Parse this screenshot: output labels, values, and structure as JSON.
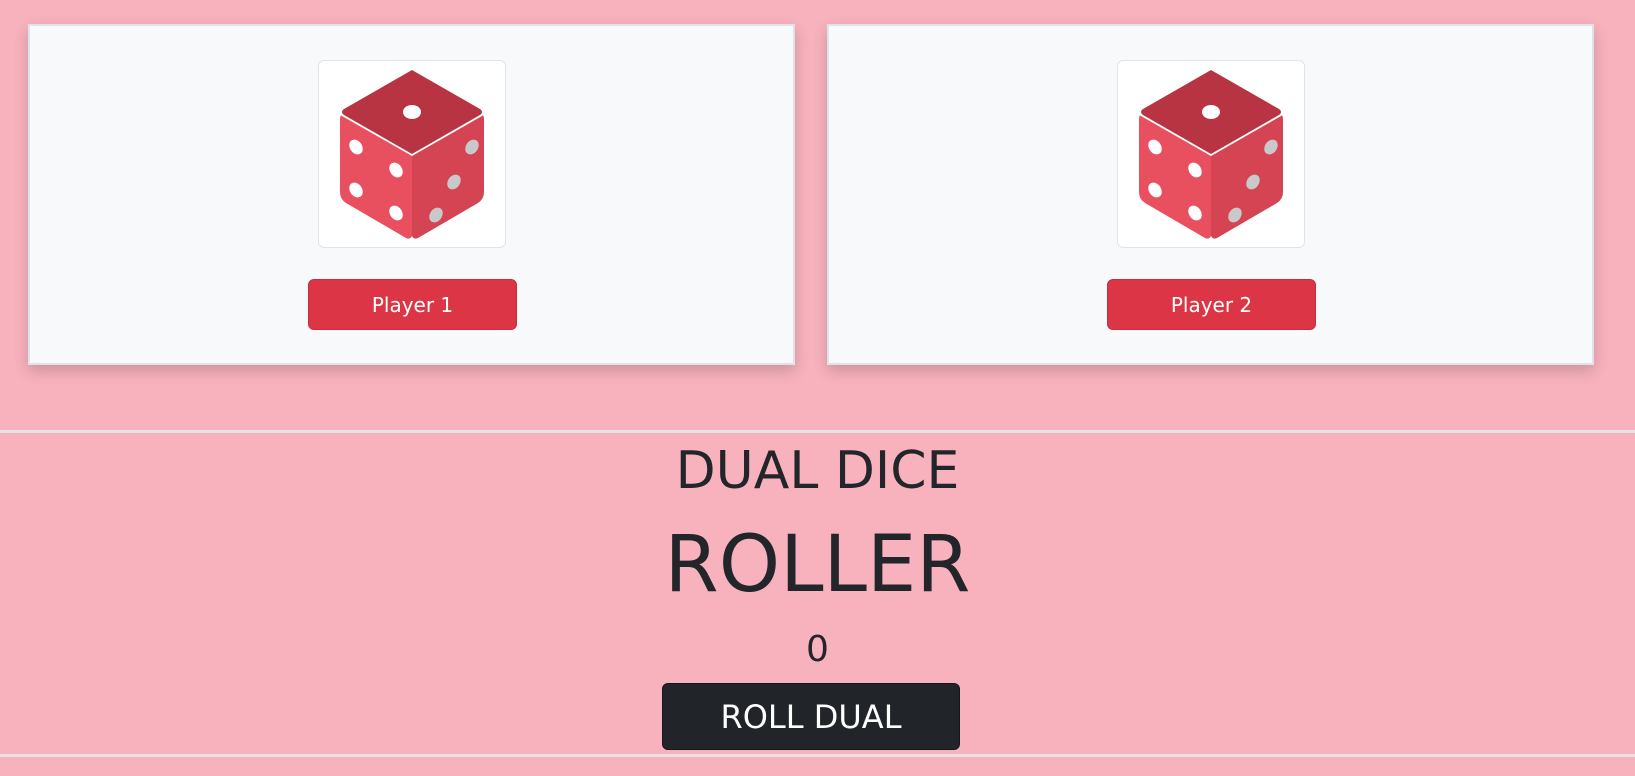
{
  "players": [
    {
      "button_label": "Player 1",
      "die_icon": "dice-icon"
    },
    {
      "button_label": "Player 2",
      "die_icon": "dice-icon"
    }
  ],
  "game": {
    "title_line1": "DUAL DICE",
    "title_line2": "ROLLER",
    "score": "0",
    "roll_button_label": "ROLL DUAL"
  },
  "colors": {
    "background": "#f8b2bd",
    "card_background": "#f7f9fb",
    "player_button": "#dc3545",
    "roll_button": "#212428",
    "text": "#22252a"
  }
}
